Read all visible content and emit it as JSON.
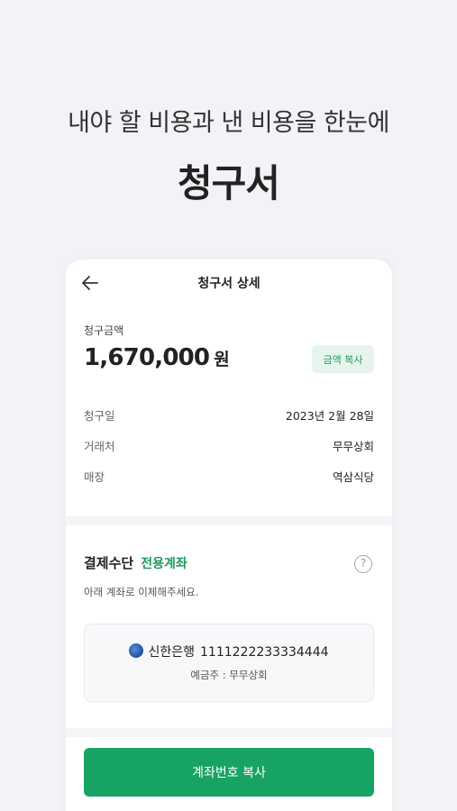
{
  "promo": {
    "headline": "내야 할 비용과 낸 비용을 한눈에",
    "title": "청구서"
  },
  "screen": {
    "title": "청구서 상세",
    "amount_label": "청구금액",
    "amount_value": "1,670,000",
    "amount_unit": "원",
    "copy_amount_label": "금액 복사",
    "details": [
      {
        "label": "청구일",
        "value": "2023년 2월 28일"
      },
      {
        "label": "거래처",
        "value": "무무상회"
      },
      {
        "label": "매장",
        "value": "역삼식당"
      }
    ],
    "payment": {
      "heading": "결제수단",
      "type": "전용계좌",
      "help_symbol": "?",
      "description": "아래 계좌로 이체해주세요.",
      "bank_name": "신한은행",
      "account_number": "1111222233334444",
      "holder": "예금주 : 무무상회"
    },
    "copy_account_label": "계좌번호 복사"
  },
  "colors": {
    "background": "#f1f3f6",
    "accent_green": "#17a463",
    "chip_bg": "#e6f5ec"
  },
  "icons": [
    "back-arrow-icon",
    "help-icon",
    "bank-logo-icon"
  ]
}
